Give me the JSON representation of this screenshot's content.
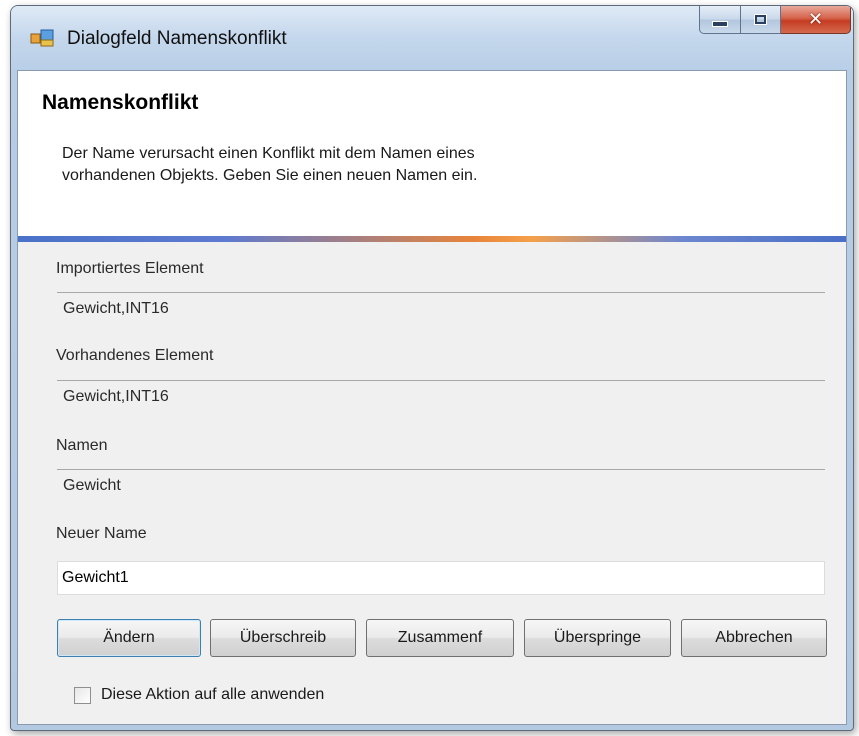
{
  "window": {
    "title": "Dialogfeld Namenskonflikt",
    "icon": "app-window-icon",
    "caption_buttons": [
      "minimize-icon",
      "maximize-icon",
      "close-icon"
    ]
  },
  "header": {
    "title": "Namenskonflikt",
    "description_line1": "Der Name verursacht einen Konflikt mit dem Namen eines",
    "description_line2": "vorhandenen Objekts. Geben Sie einen neuen Namen ein."
  },
  "fields": {
    "imported_label": "Importiertes Element",
    "imported_value": "Gewicht,INT16",
    "existing_label": "Vorhandenes Element",
    "existing_value": "Gewicht,INT16",
    "names_label": "Namen",
    "names_value": "Gewicht",
    "new_name_label": "Neuer Name",
    "new_name_value": "Gewicht1"
  },
  "buttons": {
    "change": "Ändern",
    "overwrite": "Überschreib",
    "merge": "Zusammenf",
    "skip": "Überspringe",
    "cancel": "Abbrechen"
  },
  "checkbox": {
    "label": "Diese Aktion auf alle anwenden",
    "checked": false
  },
  "colors": {
    "accent_blue": "#4a72c8",
    "accent_orange": "#e8843a",
    "close_red": "#c53c22"
  }
}
